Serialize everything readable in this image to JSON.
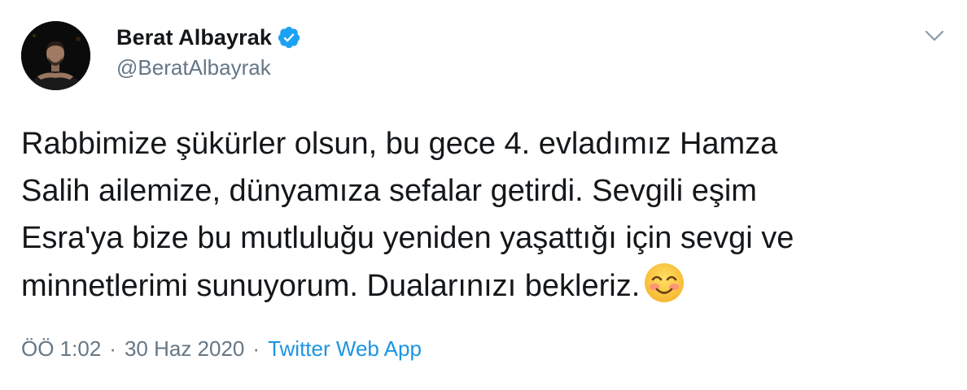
{
  "user": {
    "display_name": "Berat Albayrak",
    "handle": "@BeratAlbayrak",
    "verified": true
  },
  "tweet": {
    "text": "Rabbimize şükürler olsun, bu gece 4. evladımız Hamza\nSalih ailemize, dünyamıza sefalar getirdi. Sevgili eşim\nEsra'ya bize bu mutluluğu yeniden yaşattığı için sevgi ve\nminnetlerimi sunuyorum. Dualarınızı bekleriz.",
    "emoji": "smiling-face-with-smiling-eyes"
  },
  "meta": {
    "time": "ÖÖ 1:02",
    "separator": "·",
    "date": "30 Haz 2020",
    "source": "Twitter Web App"
  },
  "icons": {
    "verified": "verified-badge-icon",
    "caret": "chevron-down-icon"
  },
  "colors": {
    "verified_blue": "#1da1f2",
    "link_blue": "#1b95e0",
    "secondary_text": "#657786",
    "primary_text": "#14171a"
  }
}
